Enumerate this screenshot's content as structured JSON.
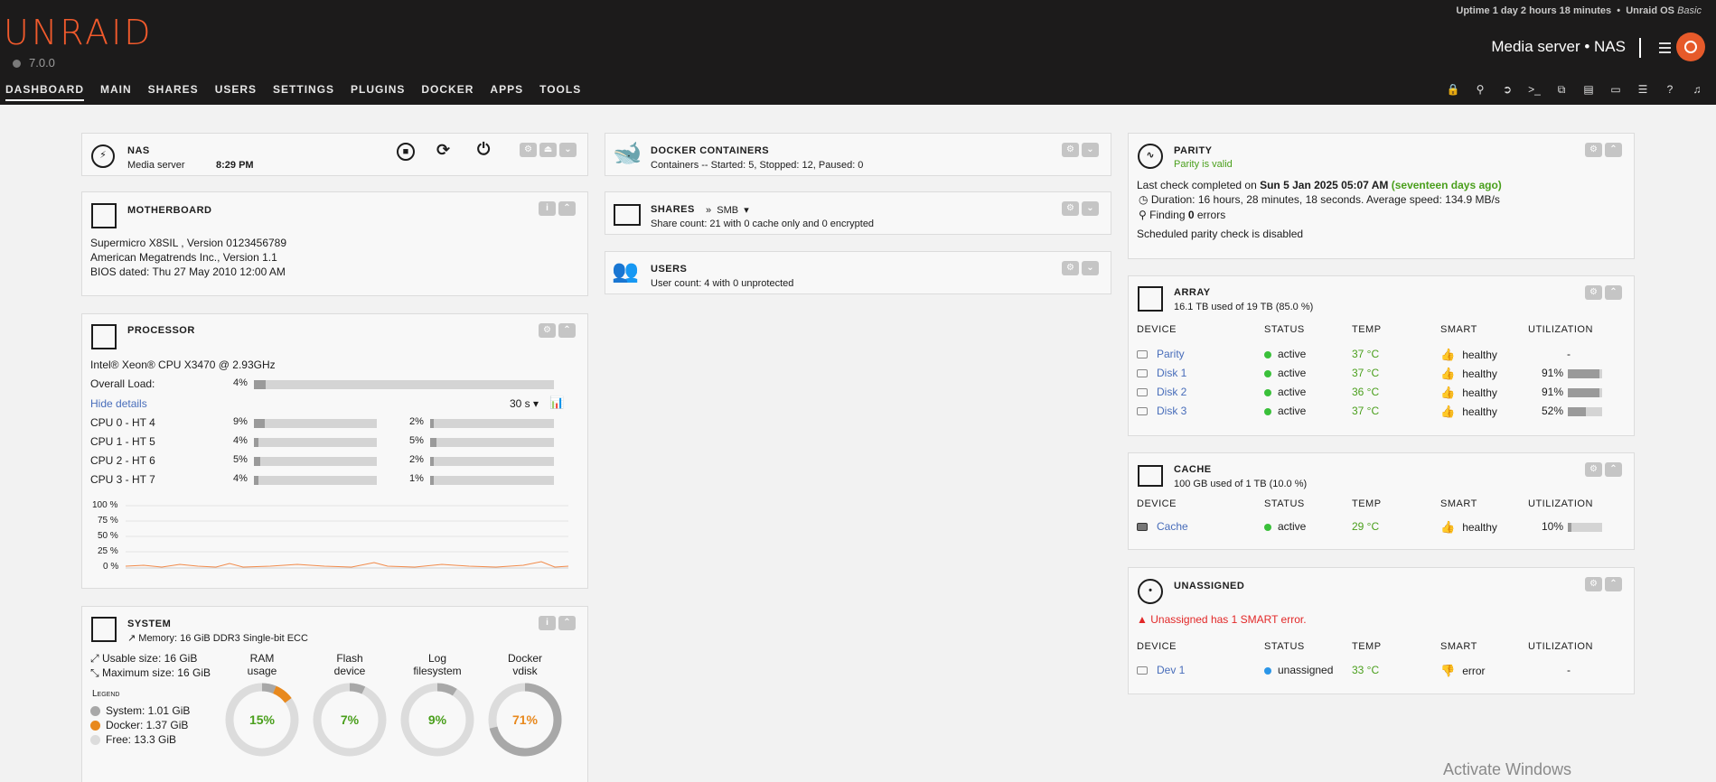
{
  "header": {
    "logo": "UNRAID",
    "version": "7.0.0",
    "uptime": "Uptime 1 day 2 hours 18 minutes",
    "os_label": "Unraid OS",
    "os_edition": "Basic",
    "server_name": "Media server",
    "server_host": "NAS",
    "nav": [
      "DASHBOARD",
      "MAIN",
      "SHARES",
      "USERS",
      "SETTINGS",
      "PLUGINS",
      "DOCKER",
      "APPS",
      "TOOLS"
    ]
  },
  "nas": {
    "title": "NAS",
    "desc": "Media server",
    "time": "8:29 PM"
  },
  "motherboard": {
    "title": "MOTHERBOARD",
    "lines": [
      "Supermicro X8SIL , Version 0123456789",
      "American Megatrends Inc., Version 1.1",
      "BIOS dated: Thu 27 May 2010 12:00 AM"
    ]
  },
  "processor": {
    "title": "PROCESSOR",
    "cpu": "Intel® Xeon® CPU X3470 @ 2.93GHz",
    "overall_label": "Overall Load:",
    "overall": "4%",
    "overall_frac": 0.04,
    "hide_details": "Hide details",
    "interval": "30 s",
    "cores": [
      {
        "label": "CPU 0 - HT 4",
        "a": "9%",
        "af": 0.09,
        "b": "2%",
        "bf": 0.02
      },
      {
        "label": "CPU 1 - HT 5",
        "a": "4%",
        "af": 0.04,
        "b": "5%",
        "bf": 0.05
      },
      {
        "label": "CPU 2 - HT 6",
        "a": "5%",
        "af": 0.05,
        "b": "2%",
        "bf": 0.02
      },
      {
        "label": "CPU 3 - HT 7",
        "a": "4%",
        "af": 0.04,
        "b": "1%",
        "bf": 0.01
      }
    ],
    "yticks": [
      "100 %",
      "75 %",
      "50 %",
      "25 %",
      "0 %"
    ]
  },
  "system": {
    "title": "SYSTEM",
    "memory": "Memory: 16 GiB DDR3 Single-bit ECC",
    "usable": "Usable size: 16 GiB",
    "maximum": "Maximum size: 16 GiB",
    "legend_title": "Legend",
    "legend": [
      "System: 1.01 GiB",
      "Docker: 1.37 GiB",
      "Free: 13.3 GiB"
    ],
    "donuts": [
      {
        "label1": "RAM",
        "label2": "usage",
        "value": "15%",
        "pct": 15
      },
      {
        "label1": "Flash",
        "label2": "device",
        "value": "7%",
        "pct": 7
      },
      {
        "label1": "Log",
        "label2": "filesystem",
        "value": "9%",
        "pct": 9
      },
      {
        "label1": "Docker",
        "label2": "vdisk",
        "value": "71%",
        "pct": 71
      }
    ]
  },
  "docker": {
    "title": "DOCKER CONTAINERS",
    "desc": "Containers -- Started: 5, Stopped: 12, Paused: 0"
  },
  "shares": {
    "title": "SHARES",
    "smb": "SMB",
    "desc": "Share count: 21 with 0 cache only and 0 encrypted"
  },
  "users": {
    "title": "USERS",
    "desc": "User count: 4 with 0 unprotected"
  },
  "parity": {
    "title": "PARITY",
    "status": "Parity is valid",
    "last_prefix": "Last check completed on",
    "last_date": "Sun 5 Jan 2025 05:07 AM",
    "last_ago": "(seventeen days ago)",
    "duration": "Duration: 16 hours, 28 minutes, 18 seconds. Average speed: 134.9 MB/s",
    "finding_prefix": "Finding",
    "finding_count": "0",
    "finding_suffix": "errors",
    "scheduled": "Scheduled parity check is disabled"
  },
  "columns": [
    "DEVICE",
    "STATUS",
    "TEMP",
    "SMART",
    "UTILIZATION"
  ],
  "array": {
    "title": "ARRAY",
    "desc": "16.1 TB used of 19 TB (85.0 %)",
    "rows": [
      {
        "device": "Parity",
        "status": "active",
        "temp": "37 °C",
        "smart": "healthy",
        "util": "-",
        "frac": null
      },
      {
        "device": "Disk 1",
        "status": "active",
        "temp": "37 °C",
        "smart": "healthy",
        "util": "91%",
        "frac": 0.91
      },
      {
        "device": "Disk 2",
        "status": "active",
        "temp": "36 °C",
        "smart": "healthy",
        "util": "91%",
        "frac": 0.91
      },
      {
        "device": "Disk 3",
        "status": "active",
        "temp": "37 °C",
        "smart": "healthy",
        "util": "52%",
        "frac": 0.52
      }
    ]
  },
  "cache": {
    "title": "CACHE",
    "desc": "100 GB used of 1 TB (10.0 %)",
    "rows": [
      {
        "device": "Cache",
        "status": "active",
        "temp": "29 °C",
        "smart": "healthy",
        "util": "10%",
        "frac": 0.1
      }
    ]
  },
  "unassigned": {
    "title": "UNASSIGNED",
    "warning": "Unassigned has 1 SMART error.",
    "rows": [
      {
        "device": "Dev 1",
        "status": "unassigned",
        "temp": "33 °C",
        "smart": "error",
        "util": "-"
      }
    ]
  },
  "watermark": "Activate Windows"
}
